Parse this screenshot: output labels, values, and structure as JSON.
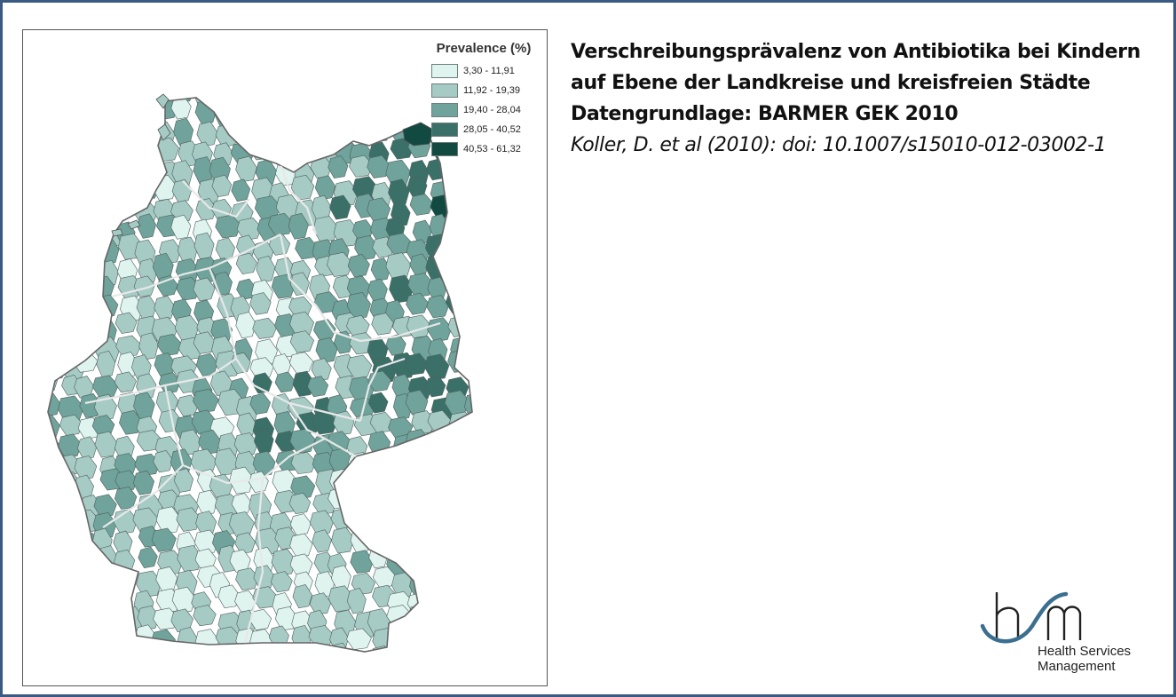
{
  "title": {
    "line1": "Verschreibungsprävalenz von Antibiotika bei Kindern",
    "line2": "auf Ebene der Landkreise und kreisfreien Städte",
    "line3": "Datengrundlage: BARMER GEK 2010",
    "citation": "Koller, D. et al (2010): doi: 10.1007/s15010-012-03002-1"
  },
  "legend": {
    "title": "Prevalence (%)",
    "items": [
      {
        "label": "3,30 - 11,91",
        "color": "#dff3ef"
      },
      {
        "label": "11,92 - 19,39",
        "color": "#a6cbc5"
      },
      {
        "label": "19,40 - 28,04",
        "color": "#6fa39b"
      },
      {
        "label": "28,05 - 40,52",
        "color": "#3b7069"
      },
      {
        "label": "40,53 - 61,32",
        "color": "#124a42"
      }
    ]
  },
  "map": {
    "border_color": "#555555",
    "state_border_color": "#e6e6e6"
  },
  "logo": {
    "line1": "Health Services",
    "line2": "Management",
    "icon": "hsm-logo-icon",
    "accent_color": "#3b6f8f"
  }
}
